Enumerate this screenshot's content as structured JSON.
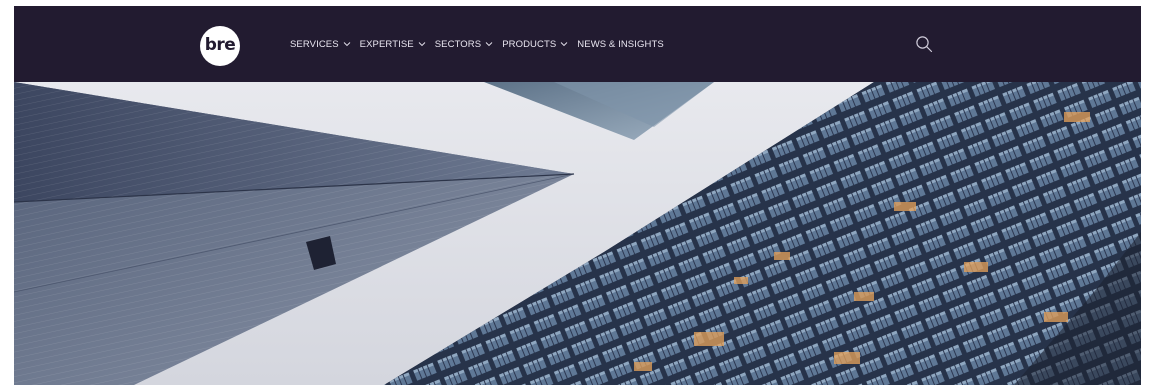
{
  "header": {
    "logo_text": "bre",
    "nav": [
      {
        "label": "SERVICES",
        "has_dropdown": true
      },
      {
        "label": "EXPERTISE",
        "has_dropdown": true
      },
      {
        "label": "SECTORS",
        "has_dropdown": true
      },
      {
        "label": "PRODUCTS",
        "has_dropdown": true
      },
      {
        "label": "NEWS & INSIGHTS",
        "has_dropdown": false
      }
    ],
    "search_icon": "search-icon"
  },
  "hero": {
    "image": "skyscrapers-looking-up-photo"
  },
  "colors": {
    "nav_background": "#221b30",
    "nav_text": "#e9e6f0",
    "logo_background": "#ffffff"
  }
}
